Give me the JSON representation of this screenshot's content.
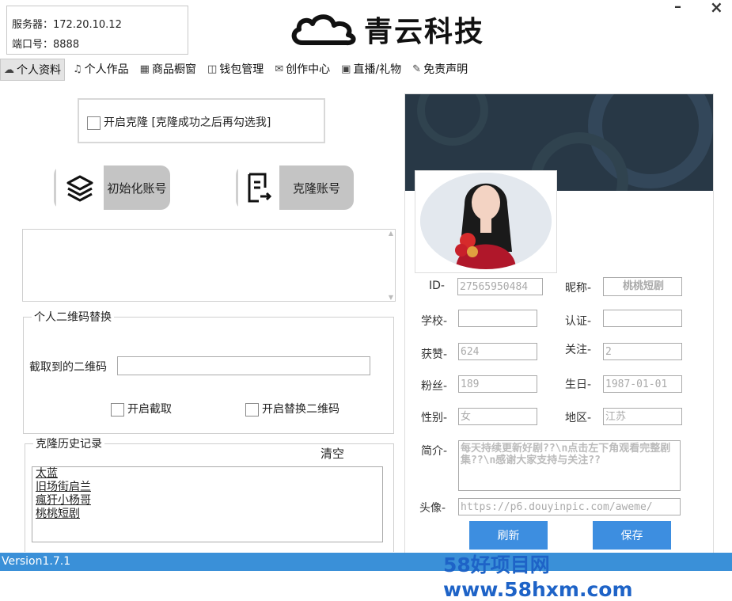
{
  "server": {
    "server_label": "服务器：172.20.10.12",
    "port_label": "端口号：8888"
  },
  "logo": {
    "text": "青云科技",
    "icon": "cloud-icon"
  },
  "window": {
    "minimize": "–",
    "close": "×"
  },
  "tabs": [
    {
      "label": "个人资料",
      "icon": "cloud-icon",
      "active": true
    },
    {
      "label": "个人作品",
      "icon": "music-icon",
      "active": false
    },
    {
      "label": "商品橱窗",
      "icon": "store-icon",
      "active": false
    },
    {
      "label": "钱包管理",
      "icon": "wallet-icon",
      "active": false
    },
    {
      "label": "创作中心",
      "icon": "mail-icon",
      "active": false
    },
    {
      "label": "直播/礼物",
      "icon": "tv-icon",
      "active": false
    },
    {
      "label": "免责声明",
      "icon": "note-icon",
      "active": false
    }
  ],
  "clone": {
    "enable_label": "开启克隆 [克隆成功之后再勾选我]"
  },
  "buttons": {
    "init_account": "初始化账号",
    "clone_account": "克隆账号"
  },
  "qr": {
    "group_title": "个人二维码替换",
    "captured_label": "截取到的二维码",
    "captured_value": "",
    "enable_capture": "开启截取",
    "enable_replace": "开启替换二维码"
  },
  "history": {
    "group_title": "克隆历史记录",
    "clear_label": "清空",
    "items": [
      "太蓝",
      "旧场街启兰",
      "瘋犴小杨哥",
      "桃桃短剧"
    ]
  },
  "profile": {
    "id_label": "ID-",
    "id_value": "27565950484",
    "nickname_label": "昵称-",
    "nickname_value": "桃桃短剧",
    "school_label": "学校-",
    "school_value": "",
    "cert_label": "认证-",
    "cert_value": "",
    "likes_label": "获赞-",
    "likes_value": "624",
    "follow_label": "关注-",
    "follow_value": "2",
    "fans_label": "粉丝-",
    "fans_value": "189",
    "birthday_label": "生日-",
    "birthday_value": "1987-01-01",
    "gender_label": "性别-",
    "gender_value": "女",
    "region_label": "地区-",
    "region_value": "江苏",
    "bio_label": "简介-",
    "bio_value": "每天持续更新好剧??\\n点击左下角观看完整剧集??\\n感谢大家支持与关注??",
    "avatar_label": "头像-",
    "avatar_value": "https://p6.douyinpic.com/aweme/",
    "refresh_label": "刷新",
    "save_label": "保存"
  },
  "footer": {
    "version": "Version1.7.1",
    "watermark": "58好项目网www.58hxm.com"
  },
  "colors": {
    "accent": "#3d8ee0",
    "footer": "#3a90d8",
    "banner": "#283846",
    "watermark": "#1e63c7"
  }
}
